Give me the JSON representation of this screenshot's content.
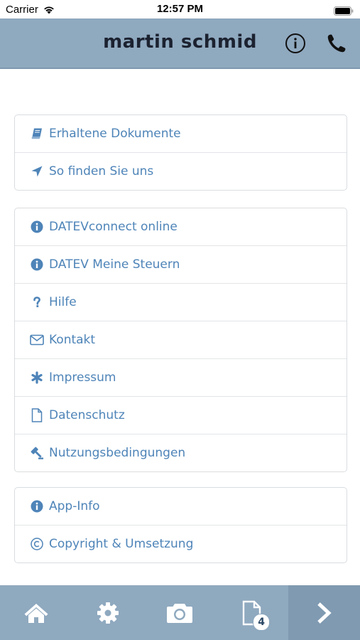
{
  "status_bar": {
    "carrier": "Carrier",
    "time": "12:57 PM"
  },
  "header": {
    "title": "martin schmid"
  },
  "groups": [
    {
      "items": [
        {
          "label": "Erhaltene Dokumente",
          "icon": "book-icon"
        },
        {
          "label": "So finden Sie uns",
          "icon": "location-arrow-icon"
        }
      ]
    },
    {
      "items": [
        {
          "label": "DATEVconnect online",
          "icon": "info-circle-icon"
        },
        {
          "label": "DATEV Meine Steuern",
          "icon": "info-circle-icon"
        },
        {
          "label": "Hilfe",
          "icon": "question-icon"
        },
        {
          "label": "Kontakt",
          "icon": "envelope-icon"
        },
        {
          "label": "Impressum",
          "icon": "asterisk-icon"
        },
        {
          "label": "Datenschutz",
          "icon": "document-icon"
        },
        {
          "label": "Nutzungsbedingungen",
          "icon": "gavel-icon"
        }
      ]
    },
    {
      "items": [
        {
          "label": "App-Info",
          "icon": "info-circle-icon"
        },
        {
          "label": "Copyright & Umsetzung",
          "icon": "copyright-icon"
        }
      ]
    }
  ],
  "tabbar": {
    "tabs": [
      {
        "icon": "home-icon"
      },
      {
        "icon": "gear-icon"
      },
      {
        "icon": "camera-icon"
      },
      {
        "icon": "document-icon",
        "badge": "4"
      },
      {
        "icon": "chevron-right-icon"
      }
    ]
  },
  "colors": {
    "accent": "#4e84b8",
    "header": "#8fa9bf",
    "title": "#1c2230"
  }
}
